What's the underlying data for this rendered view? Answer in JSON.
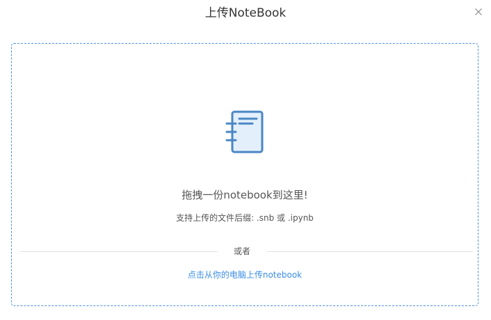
{
  "dialog": {
    "title": "上传NoteBook",
    "close_icon": "close-icon"
  },
  "dropzone": {
    "icon": "notebook-icon",
    "drag_text": "拖拽一份notebook到这里!",
    "hint_text": "支持上传的文件后缀: .snb 或 .ipynb",
    "divider_text": "或者",
    "upload_link": "点击从你的电脑上传notebook"
  },
  "colors": {
    "accent": "#4a90e2",
    "link": "#3a8ee6",
    "icon_fill": "#e3f0fc",
    "text": "#555555",
    "title": "#333333"
  }
}
